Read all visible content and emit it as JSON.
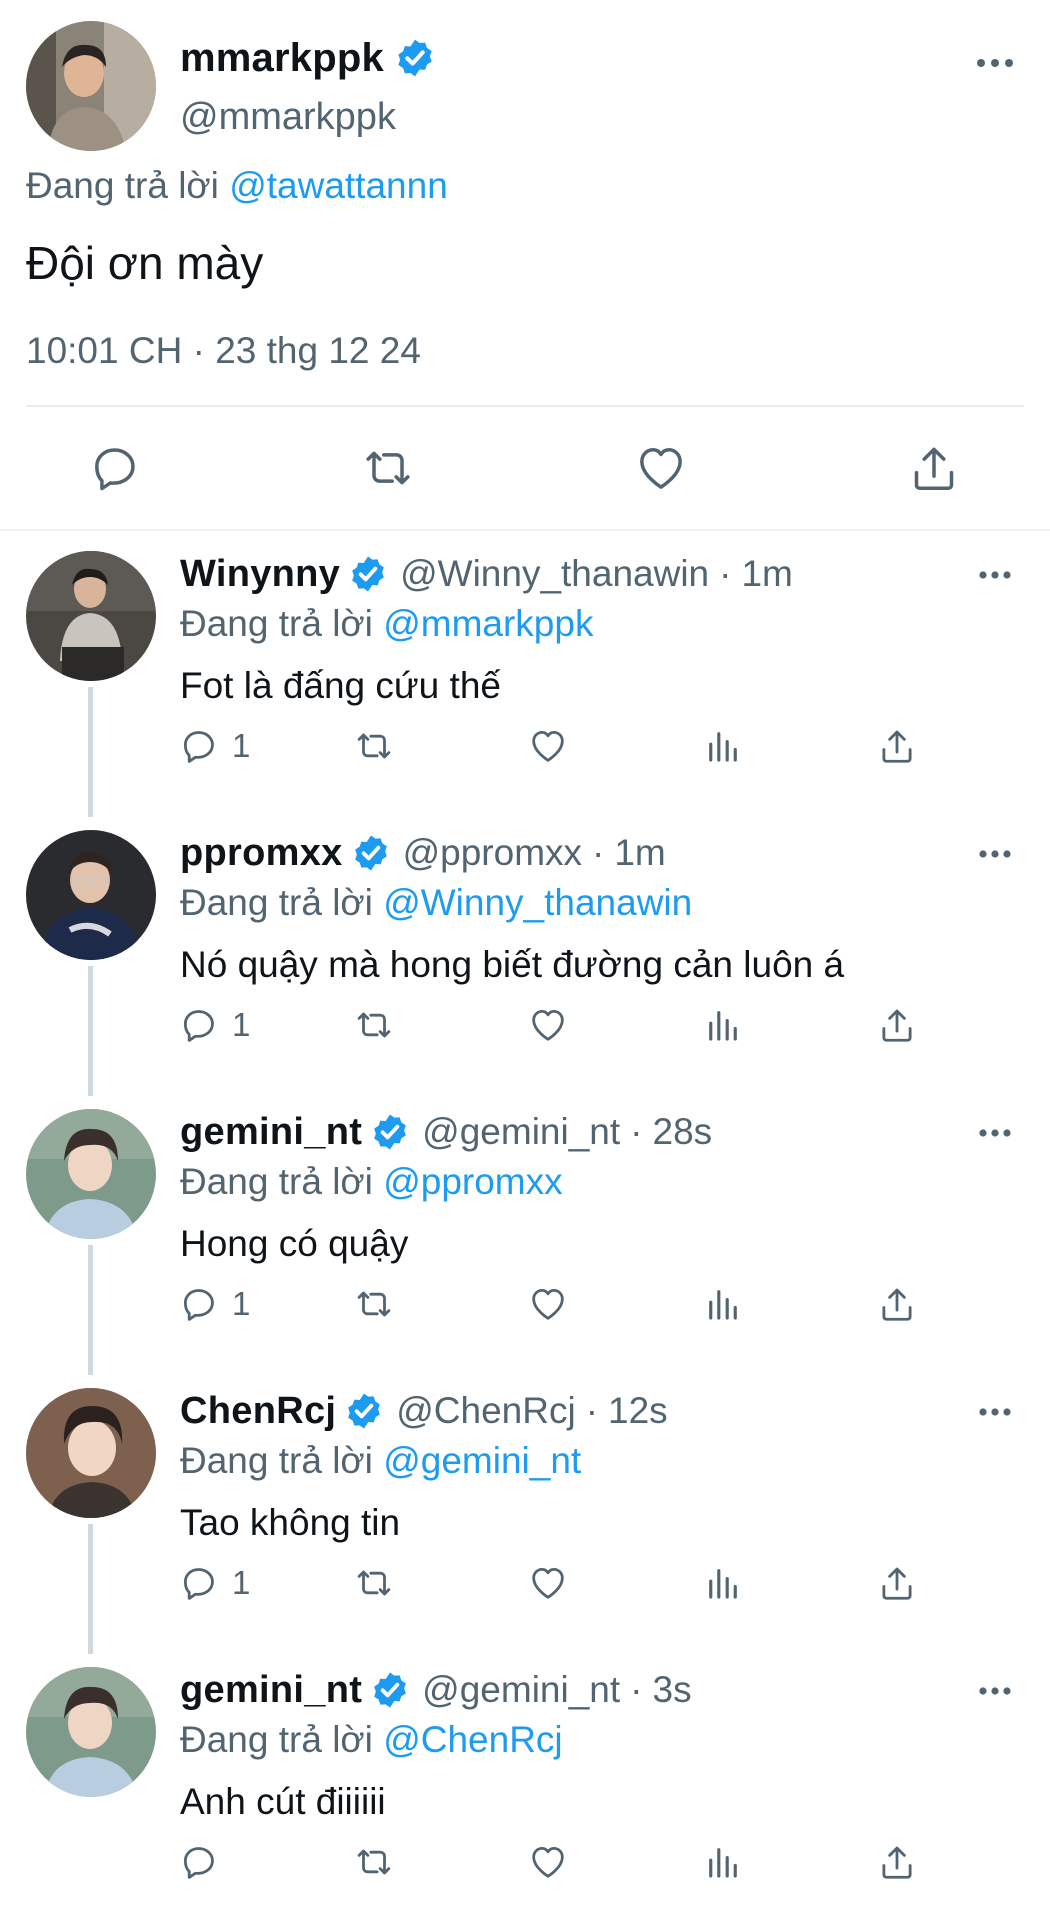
{
  "main_tweet": {
    "name": "mmarkppk",
    "handle": "@mmarkppk",
    "replying_prefix": "Đang trả lời",
    "replying_to": "@tawattannn",
    "text": "Đội ơn mày",
    "timestamp": "10:01 CH · 23 thg 12 24",
    "actions": [
      "reply-icon",
      "retweet-icon",
      "like-icon",
      "share-icon"
    ]
  },
  "replies": [
    {
      "name": "Winynny",
      "handle": "@Winny_thanawin",
      "time": "1m",
      "replying_prefix": "Đang trả lời",
      "replying_to": "@mmarkppk",
      "text": "Fot là đấng cứu thế",
      "reply_count": "1"
    },
    {
      "name": "ppromxx",
      "handle": "@ppromxx",
      "time": "1m",
      "replying_prefix": "Đang trả lời",
      "replying_to": "@Winny_thanawin",
      "text": "Nó quậy mà hong biết đường cản luôn á",
      "reply_count": "1"
    },
    {
      "name": "gemini_nt",
      "handle": "@gemini_nt",
      "time": "28s",
      "replying_prefix": "Đang trả lời",
      "replying_to": "@ppromxx",
      "text": "Hong có quậy",
      "reply_count": "1"
    },
    {
      "name": "ChenRcj",
      "handle": "@ChenRcj",
      "time": "12s",
      "replying_prefix": "Đang trả lời",
      "replying_to": "@gemini_nt",
      "text": "Tao không tin",
      "reply_count": "1"
    },
    {
      "name": "gemini_nt",
      "handle": "@gemini_nt",
      "time": "3s",
      "replying_prefix": "Đang trả lời",
      "replying_to": "@ChenRcj",
      "text": "Anh cút điiiiii",
      "reply_count": ""
    }
  ],
  "separator_dot": "·",
  "colors": {
    "accent": "#1d9bf0",
    "secondary_text": "#536471",
    "primary_text": "#0f1419",
    "thread_line": "#cfd9de"
  }
}
